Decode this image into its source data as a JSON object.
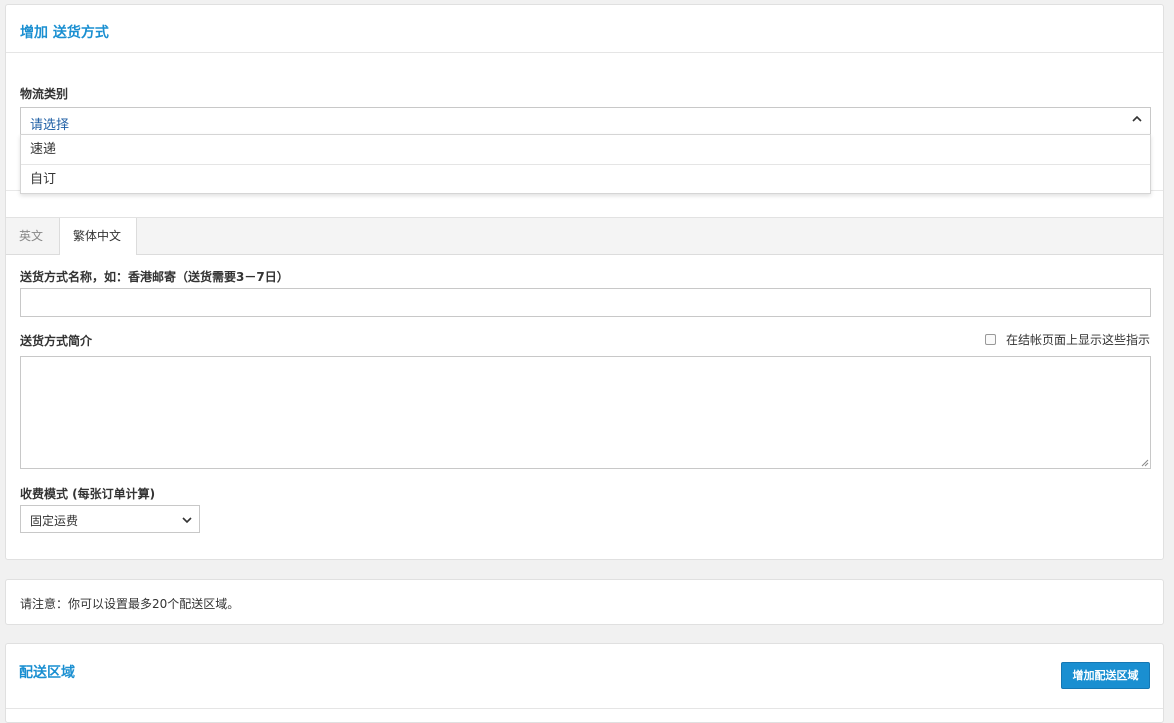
{
  "header": {
    "title": "增加 送货方式"
  },
  "logistics": {
    "label": "物流类别",
    "selected": "请选择",
    "options": [
      "速递",
      "自订"
    ]
  },
  "tabs": [
    {
      "label": "英文",
      "active": false
    },
    {
      "label": "繁体中文",
      "active": true
    }
  ],
  "form": {
    "name_label": "送货方式名称，如：香港邮寄（送货需要3－7日）",
    "name_value": "",
    "desc_label": "送货方式简介",
    "desc_value": "",
    "show_on_checkout_label": "在结帐页面上显示这些指示",
    "fee_mode_label": "收费模式 (每张订单计算)",
    "fee_mode_selected": "固定运费"
  },
  "notice": {
    "text": "请注意：你可以设置最多20个配送区域。"
  },
  "zones": {
    "title": "配送区域",
    "add_button": "增加配送区域"
  },
  "colors": {
    "accent": "#1a8fd1",
    "select_text": "#1f5fa5"
  }
}
